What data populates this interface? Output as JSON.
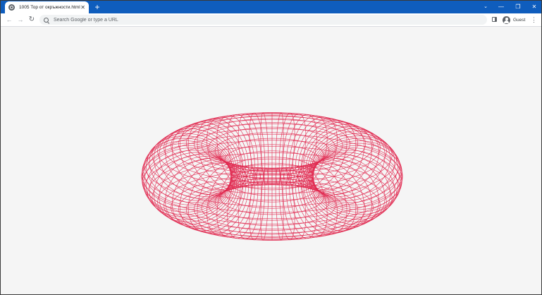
{
  "browser": {
    "tab_title": "1005 Тор от окръжности.html",
    "tab_close": "✕",
    "new_tab": "+",
    "window_controls": {
      "chevron": "⌄",
      "minimize": "—",
      "maximize": "❐",
      "close": "✕"
    },
    "nav": {
      "back": "←",
      "forward": "→",
      "reload": "↻"
    },
    "omnibox_placeholder": "Search Google or type a URL",
    "profile_label": "Guest",
    "menu": "⋮"
  },
  "scene": {
    "object": "torus-wireframe",
    "line_color": "#e0284f",
    "background": "#f5f5f5"
  }
}
